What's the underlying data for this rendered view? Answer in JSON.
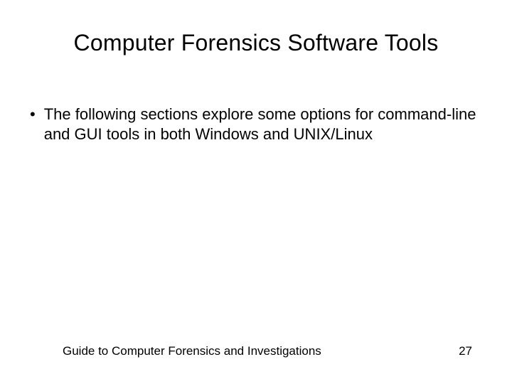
{
  "slide": {
    "title": "Computer Forensics Software Tools",
    "bullets": [
      {
        "text": "The following sections explore some options for command-line and GUI tools in both Windows and UNIX/Linux"
      }
    ],
    "footer": {
      "left": "Guide to Computer Forensics and Investigations",
      "page_number": "27"
    }
  }
}
